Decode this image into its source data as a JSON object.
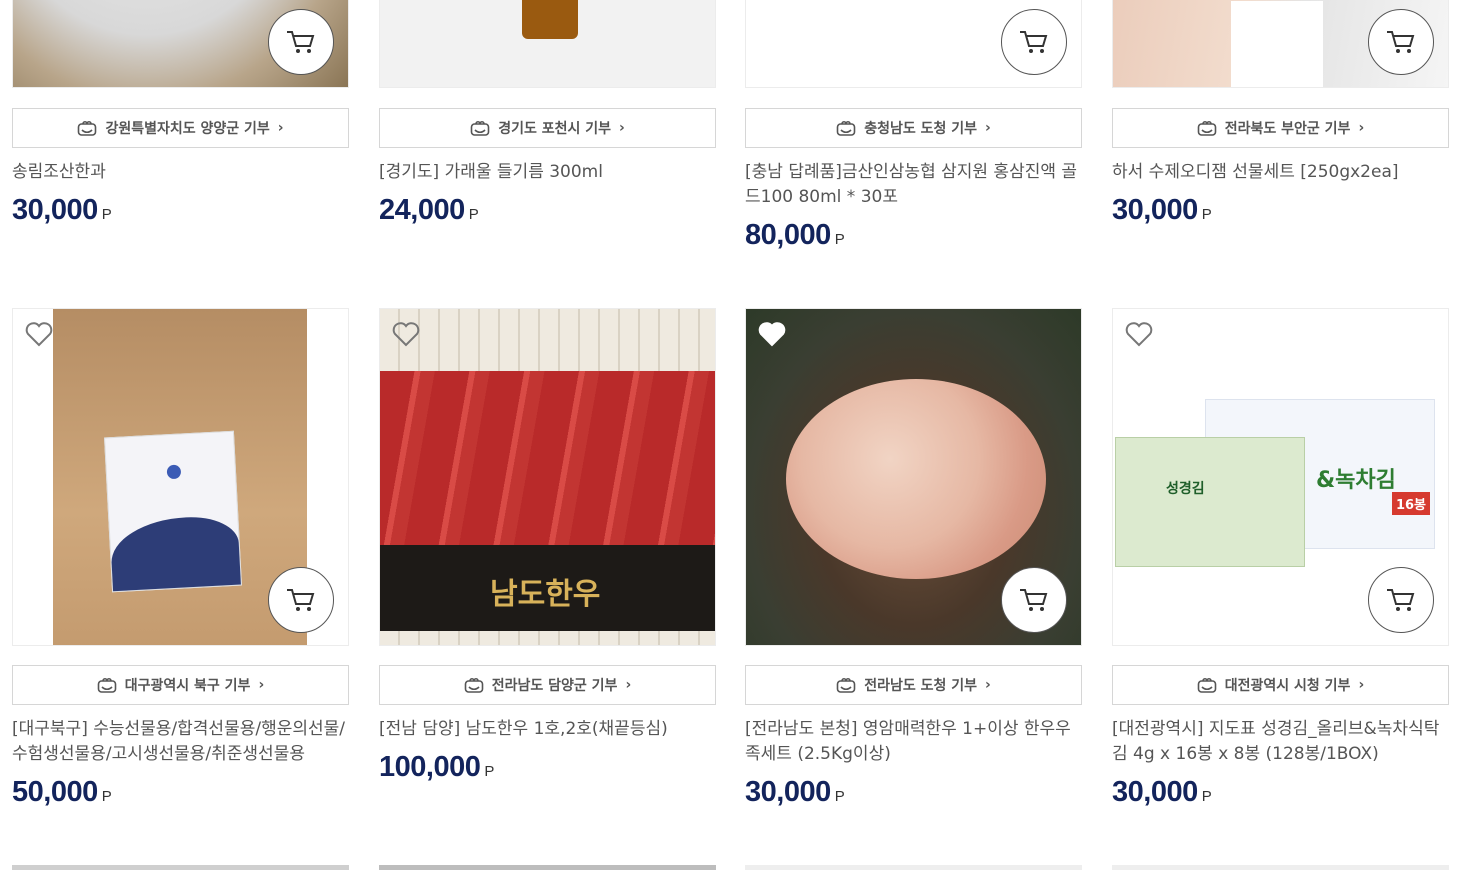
{
  "currency_unit": "P",
  "products": [
    {
      "donation": "강원특별자치도 양양군 기부",
      "name": "송림조산한과",
      "price": "30,000",
      "liked": false
    },
    {
      "donation": "경기도 포천시 기부",
      "name": "[경기도] 가래울 들기름 300ml",
      "price": "24,000",
      "liked": false
    },
    {
      "donation": "충청남도 도청 기부",
      "name": "[충남 답례품]금산인삼농협 삼지원 홍삼진액 골드100 80ml * 30포",
      "price": "80,000",
      "liked": false
    },
    {
      "donation": "전라북도 부안군 기부",
      "name": "하서 수제오디잼 선물세트 [250gx2ea]",
      "price": "30,000",
      "liked": false
    },
    {
      "donation": "대구광역시 북구 기부",
      "name": "[대구북구] 수능선물용/합격선물용/행운의선물/수험생선물용/고시생선물용/취준생선물용",
      "price": "50,000",
      "liked": false
    },
    {
      "donation": "전라남도 담양군 기부",
      "name": "[전남 담양] 남도한우 1호,2호(채끝등심)",
      "price": "100,000",
      "liked": false
    },
    {
      "donation": "전라남도 도청 기부",
      "name": "[전라남도 본청] 영암매력한우 1+이상 한우우족세트 (2.5Kg이상)",
      "price": "30,000",
      "liked": true
    },
    {
      "donation": "대전광역시 시청 기부",
      "name": "[대전광역시] 지도표 성경김_올리브&녹차식탁김 4g x 16봉 x 8봉 (128봉/1BOX)",
      "price": "30,000",
      "liked": false
    }
  ],
  "image_text": {
    "hanwoo_logo": "남도한우",
    "seaweed_brand": "성경김",
    "seaweed_label": "&녹차김",
    "seaweed_count": "16봉"
  },
  "colors": {
    "price": "#13245c",
    "border": "#d6d6d6",
    "meat": "#c8322f"
  }
}
